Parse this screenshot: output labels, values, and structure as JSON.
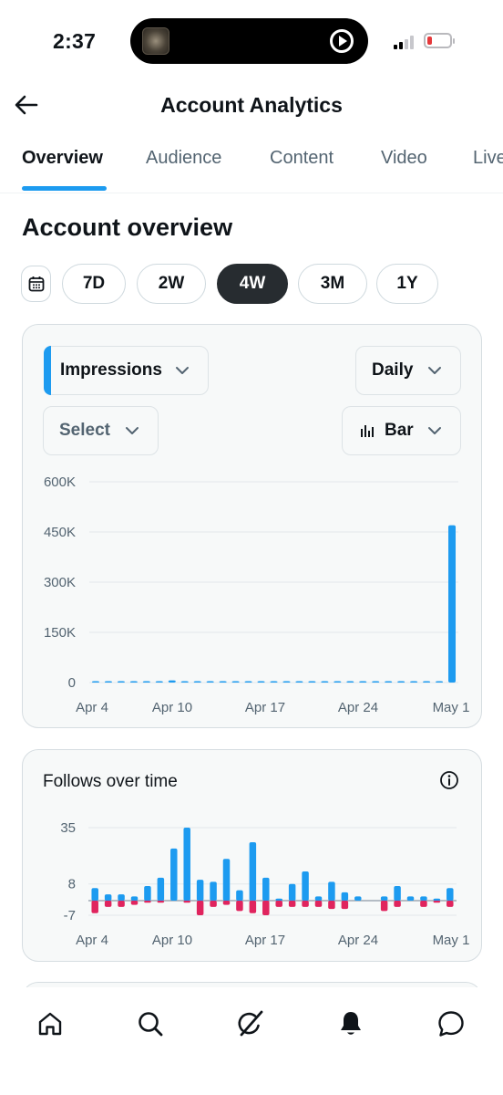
{
  "status_bar": {
    "time": "2:37",
    "battery_level": 0.2,
    "signal_bars": 2
  },
  "header": {
    "title": "Account Analytics",
    "back_icon": "arrow-left-icon"
  },
  "tabs": [
    {
      "label": "Overview",
      "active": true
    },
    {
      "label": "Audience",
      "active": false
    },
    {
      "label": "Content",
      "active": false
    },
    {
      "label": "Video",
      "active": false
    },
    {
      "label": "Live",
      "active": false
    }
  ],
  "section": {
    "title": "Account overview"
  },
  "ranges": {
    "calendar_icon": "calendar-icon",
    "options": [
      "7D",
      "2W",
      "4W",
      "3M",
      "1Y"
    ],
    "selected": "4W"
  },
  "impressions_card": {
    "metric_dropdown": "Impressions",
    "interval_dropdown": "Daily",
    "compare_dropdown": "Select",
    "type_dropdown": "Bar",
    "accent_color": "#1d9bf0"
  },
  "follows_card": {
    "title": "Follows over time",
    "info_icon": "info-icon"
  },
  "chart_data": [
    {
      "type": "bar",
      "title": "",
      "y_ticks": [
        "600K",
        "450K",
        "300K",
        "150K",
        "0"
      ],
      "ylim": [
        0,
        600000
      ],
      "x_ticks": [
        "Apr 4",
        "Apr 10",
        "Apr 17",
        "Apr 24",
        "May 1"
      ],
      "series": [
        {
          "color": "#1d9bf0",
          "values": [
            1200,
            1500,
            1300,
            1400,
            1700,
            3500,
            6500,
            2500,
            2000,
            1800,
            1500,
            2000,
            3500,
            1800,
            1500,
            1600,
            1700,
            1500,
            1400,
            3000,
            2600,
            1500,
            1300,
            1200,
            1100,
            1100,
            1000,
            1000,
            470000
          ]
        }
      ],
      "grid": true
    },
    {
      "type": "bar",
      "title": "Follows over time",
      "y_ticks": [
        "35",
        "8",
        "-7"
      ],
      "ylim": [
        -7,
        35
      ],
      "x_ticks": [
        "Apr 4",
        "Apr 10",
        "Apr 17",
        "Apr 24",
        "May 1"
      ],
      "series": [
        {
          "color": "#1d9bf0",
          "values": [
            6,
            3,
            3,
            2,
            7,
            11,
            25,
            35,
            10,
            9,
            20,
            5,
            28,
            11,
            1,
            8,
            14,
            2,
            9,
            4,
            2,
            0,
            2,
            7,
            2,
            2,
            1,
            6
          ]
        },
        {
          "color": "#e0245e",
          "values": [
            -6,
            -3,
            -3,
            -2,
            -1,
            -1,
            0,
            -1,
            -7,
            -3,
            -2,
            -5,
            -6,
            -7,
            -3,
            -3,
            -3,
            -3,
            -4,
            -4,
            0,
            0,
            -5,
            -3,
            0,
            -3,
            -1,
            -3
          ]
        }
      ],
      "grid": true
    }
  ],
  "bottom_nav": [
    {
      "name": "home",
      "icon": "home-icon"
    },
    {
      "name": "search",
      "icon": "search-icon"
    },
    {
      "name": "grok",
      "icon": "grok-icon"
    },
    {
      "name": "notifications",
      "icon": "bell-icon"
    },
    {
      "name": "messages",
      "icon": "chat-icon"
    }
  ]
}
